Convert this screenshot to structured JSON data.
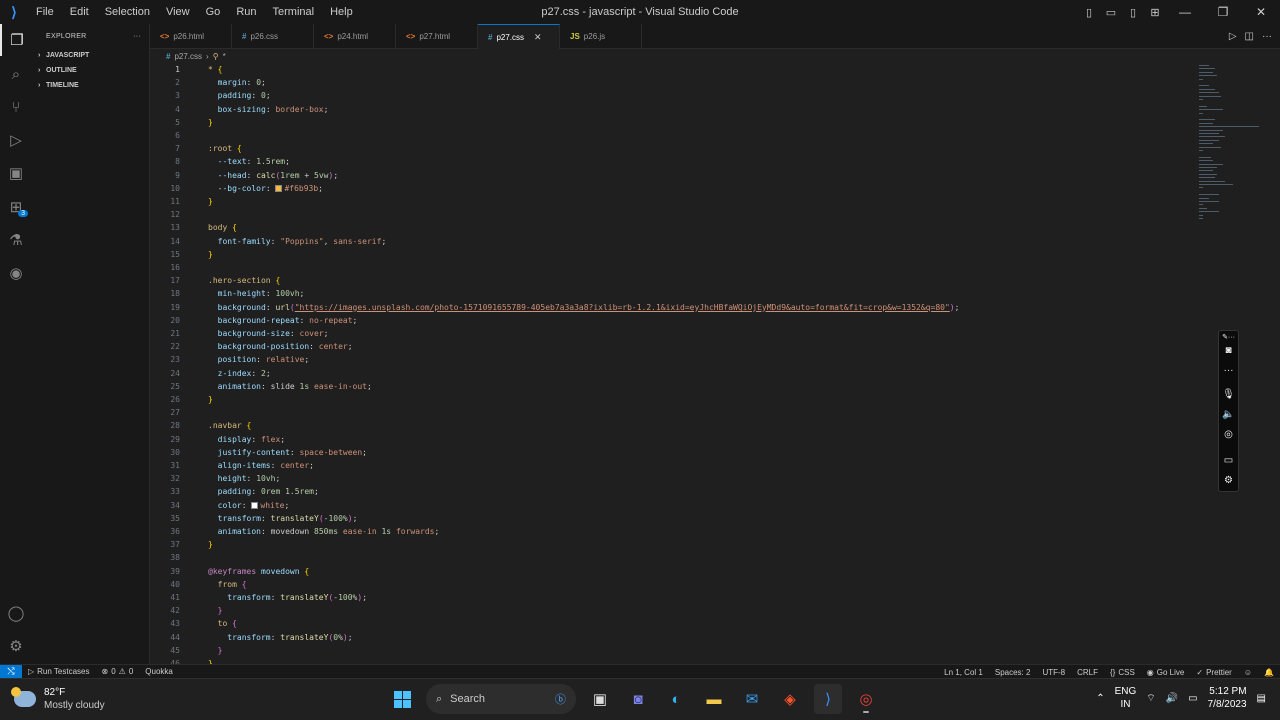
{
  "window": {
    "title": "p27.css - javascript - Visual Studio Code"
  },
  "menu": [
    "File",
    "Edit",
    "Selection",
    "View",
    "Go",
    "Run",
    "Terminal",
    "Help"
  ],
  "explorer": {
    "title": "EXPLORER",
    "sections": [
      "JAVASCRIPT",
      "OUTLINE",
      "TIMELINE"
    ]
  },
  "tabs": [
    {
      "name": "p26.html",
      "type": "html",
      "icon": "<>"
    },
    {
      "name": "p26.css",
      "type": "css",
      "icon": "#"
    },
    {
      "name": "p24.html",
      "type": "html",
      "icon": "<>"
    },
    {
      "name": "p27.html",
      "type": "html",
      "icon": "<>"
    },
    {
      "name": "p27.css",
      "type": "css",
      "icon": "#",
      "active": true
    },
    {
      "name": "p26.js",
      "type": "js",
      "icon": "JS"
    }
  ],
  "breadcrumb": {
    "file": "p27.css",
    "symbol": "*"
  },
  "editor": {
    "current_line": 1,
    "start_line": 1
  },
  "status": {
    "run_testcases": "Run Testcases",
    "errors": "0",
    "warnings": "0",
    "quokka": "Quokka",
    "position": "Ln 1, Col 1",
    "spaces": "Spaces: 2",
    "encoding": "UTF-8",
    "eol": "CRLF",
    "language": "CSS",
    "golive": "Go Live",
    "prettier": "Prettier"
  },
  "taskbar": {
    "temp": "82°F",
    "weather": "Mostly cloudy",
    "search": "Search",
    "lang1": "ENG",
    "lang2": "IN",
    "time": "5:12 PM",
    "date": "7/8/2023"
  }
}
